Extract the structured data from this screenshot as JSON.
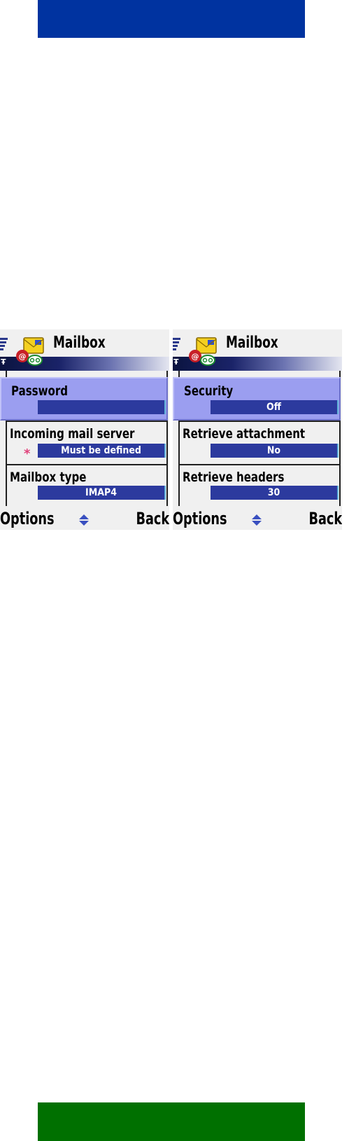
{
  "screens": [
    {
      "title": "Mailbox",
      "rows": [
        {
          "label": "Password",
          "value": "",
          "required": false,
          "selected": true
        },
        {
          "label": "Incoming mail server",
          "value": "Must be defined",
          "required": true,
          "selected": false
        },
        {
          "label": "Mailbox type",
          "value": "IMAP4",
          "required": false,
          "selected": false
        }
      ],
      "softkeys": {
        "left": "Options",
        "right": "Back"
      }
    },
    {
      "title": "Mailbox",
      "rows": [
        {
          "label": "Security",
          "value": "Off",
          "required": false,
          "selected": true
        },
        {
          "label": "Retrieve attachment",
          "value": "No",
          "required": false,
          "selected": false
        },
        {
          "label": "Retrieve headers",
          "value": "30",
          "required": false,
          "selected": false
        }
      ],
      "softkeys": {
        "left": "Options",
        "right": "Back"
      }
    }
  ],
  "required_marker": "*",
  "colors": {
    "top_bar": "#0033a0",
    "bottom_bar": "#007000",
    "selection": "#9b9ef0",
    "value_field": "#2c3a9e",
    "required_marker": "#e0407a"
  },
  "icons": {
    "status": "signal-strength-icon",
    "app": "mailbox-icon",
    "scroll": "scroll-up-down-icon"
  }
}
